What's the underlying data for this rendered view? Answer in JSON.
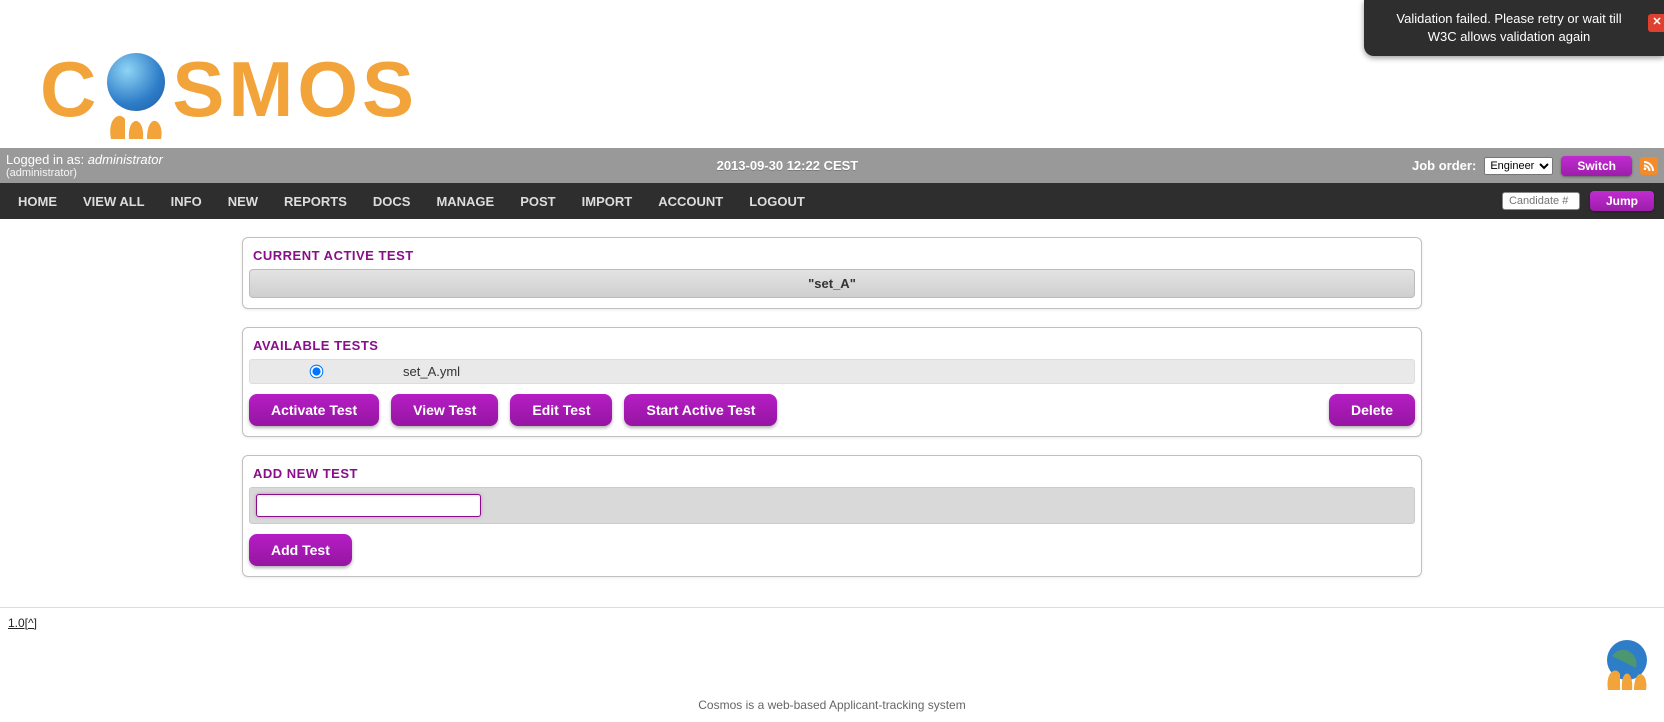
{
  "toast": {
    "message": "Validation failed. Please retry or wait till W3C allows validation again"
  },
  "logo": {
    "text_before": "C",
    "text_after": "SMOS"
  },
  "topbar": {
    "logged_in_prefix": "Logged in as: ",
    "username": "administrator",
    "role": "(administrator)",
    "center": "2013-09-30 12:22 CEST",
    "job_order_label": "Job order:",
    "job_order_value": "Engineer",
    "switch_label": "Switch"
  },
  "nav": {
    "items": [
      "HOME",
      "VIEW ALL",
      "INFO",
      "NEW",
      "REPORTS",
      "DOCS",
      "MANAGE",
      "POST",
      "IMPORT",
      "ACCOUNT",
      "LOGOUT"
    ],
    "candidate_placeholder": "Candidate #",
    "jump_label": "Jump"
  },
  "panels": {
    "current": {
      "title": "CURRENT ACTIVE TEST",
      "value": "\"set_A\""
    },
    "available": {
      "title": "AVAILABLE TESTS",
      "rows": [
        {
          "file": "set_A.yml",
          "selected": true
        }
      ],
      "buttons": {
        "activate": "Activate Test",
        "view": "View Test",
        "edit": "Edit Test",
        "start": "Start Active Test",
        "delete": "Delete"
      }
    },
    "add": {
      "title": "ADD NEW TEST",
      "button": "Add Test",
      "value": ""
    }
  },
  "footer": {
    "version": "1.0[^]",
    "tagline": "Cosmos is a web-based Applicant-tracking system"
  }
}
